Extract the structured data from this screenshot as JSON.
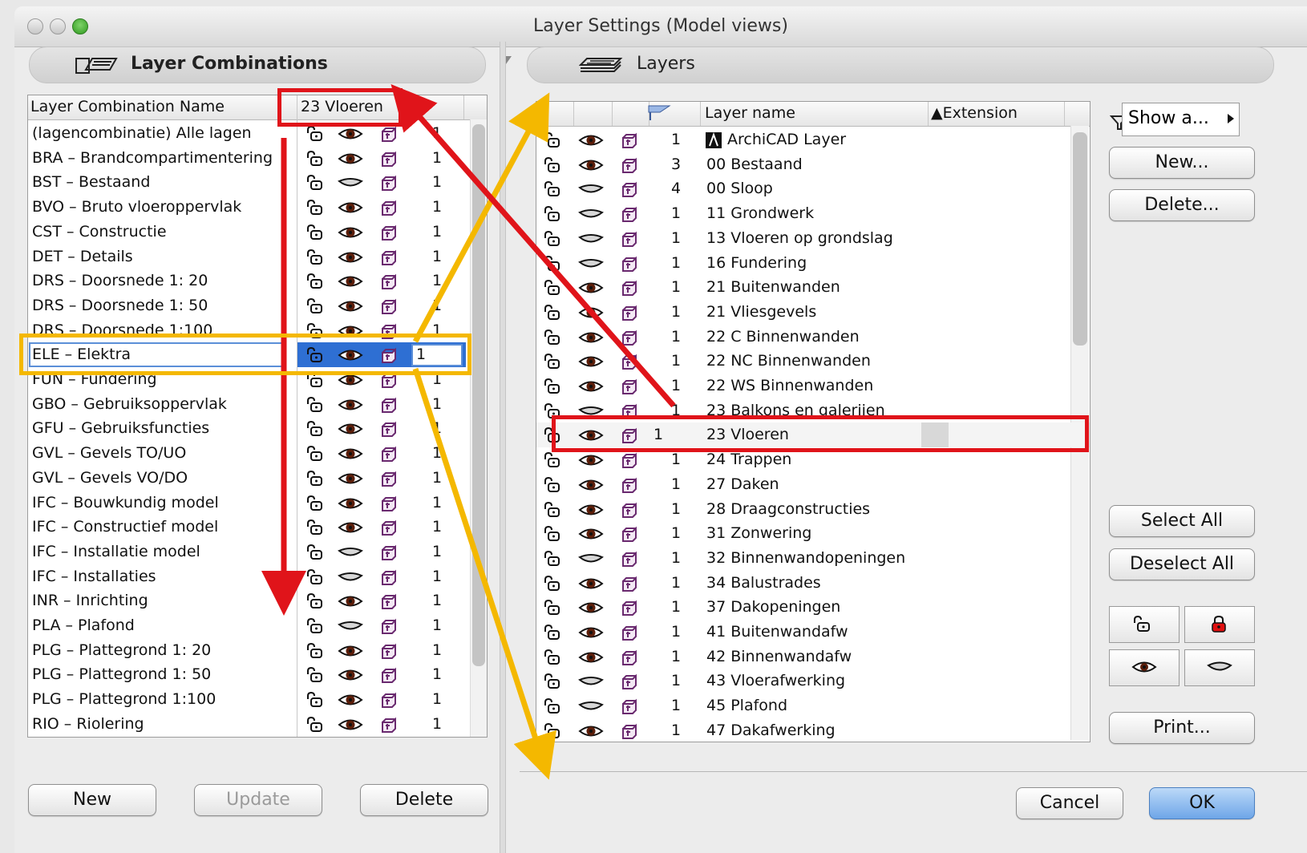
{
  "window": {
    "title": "Layer Settings (Model views)"
  },
  "left_panel": {
    "title": "Layer Combinations",
    "col_name": "Layer Combination Name",
    "col_combo": "23 Vloeren",
    "rows": [
      {
        "name": "(lagencombinatie) Alle lagen",
        "num": "1",
        "visible": true
      },
      {
        "name": "BRA – Brandcompartimentering",
        "num": "1",
        "visible": true
      },
      {
        "name": "BST – Bestaand",
        "num": "1",
        "visible": false
      },
      {
        "name": "BVO – Bruto vloeroppervlak",
        "num": "1",
        "visible": true
      },
      {
        "name": "CST – Constructie",
        "num": "1",
        "visible": true
      },
      {
        "name": "DET – Details",
        "num": "1",
        "visible": true
      },
      {
        "name": "DRS – Doorsnede 1: 20",
        "num": "1",
        "visible": true
      },
      {
        "name": "DRS – Doorsnede 1: 50",
        "num": "1",
        "visible": true
      },
      {
        "name": "DRS – Doorsnede 1:100",
        "num": "1",
        "visible": true
      },
      {
        "name": "ELE – Elektra",
        "num": "1",
        "visible": true
      },
      {
        "name": "FUN – Fundering",
        "num": "1",
        "visible": true
      },
      {
        "name": "GBO – Gebruiksoppervlak",
        "num": "1",
        "visible": true
      },
      {
        "name": "GFU – Gebruiksfuncties",
        "num": "1",
        "visible": true
      },
      {
        "name": "GVL – Gevels TO/UO",
        "num": "1",
        "visible": true
      },
      {
        "name": "GVL – Gevels VO/DO",
        "num": "1",
        "visible": true
      },
      {
        "name": "IFC – Bouwkundig model",
        "num": "1",
        "visible": true
      },
      {
        "name": "IFC – Constructief model",
        "num": "1",
        "visible": true
      },
      {
        "name": "IFC – Installatie model",
        "num": "1",
        "visible": false
      },
      {
        "name": "IFC – Installaties",
        "num": "1",
        "visible": false
      },
      {
        "name": "INR – Inrichting",
        "num": "1",
        "visible": true
      },
      {
        "name": "PLA – Plafond",
        "num": "1",
        "visible": false
      },
      {
        "name": "PLG – Plattegrond 1: 20",
        "num": "1",
        "visible": true
      },
      {
        "name": "PLG – Plattegrond 1: 50",
        "num": "1",
        "visible": true
      },
      {
        "name": "PLG – Plattegrond 1:100",
        "num": "1",
        "visible": true
      },
      {
        "name": "RIO – Riolering",
        "num": "1",
        "visible": true
      }
    ],
    "selected_row": 9,
    "buttons": {
      "new": "New",
      "update": "Update",
      "delete": "Delete"
    }
  },
  "right_panel": {
    "title": "Layers",
    "col_name": "Layer name",
    "col_ext": "▲Extension",
    "rows": [
      {
        "name": "ArchiCAD Layer",
        "num": "1",
        "visible": true,
        "special": true
      },
      {
        "name": "00 Bestaand",
        "num": "3",
        "visible": true
      },
      {
        "name": "00 Sloop",
        "num": "4",
        "visible": false
      },
      {
        "name": "11 Grondwerk",
        "num": "1",
        "visible": false
      },
      {
        "name": "13 Vloeren op grondslag",
        "num": "1",
        "visible": false
      },
      {
        "name": "16 Fundering",
        "num": "1",
        "visible": false
      },
      {
        "name": "21 Buitenwanden",
        "num": "1",
        "visible": true
      },
      {
        "name": "21 Vliesgevels",
        "num": "1",
        "visible": true
      },
      {
        "name": "22 C Binnenwanden",
        "num": "1",
        "visible": true
      },
      {
        "name": "22 NC Binnenwanden",
        "num": "1",
        "visible": true
      },
      {
        "name": "22 WS Binnenwanden",
        "num": "1",
        "visible": true
      },
      {
        "name": "23 Balkons en galerijen",
        "num": "1",
        "visible": false
      },
      {
        "name": "23 Vloeren",
        "num": "1",
        "visible": true
      },
      {
        "name": "24 Trappen",
        "num": "1",
        "visible": true
      },
      {
        "name": "27 Daken",
        "num": "1",
        "visible": true
      },
      {
        "name": "28 Draagconstructies",
        "num": "1",
        "visible": true
      },
      {
        "name": "31 Zonwering",
        "num": "1",
        "visible": true
      },
      {
        "name": "32 Binnenwandopeningen",
        "num": "1",
        "visible": false
      },
      {
        "name": "34 Balustrades",
        "num": "1",
        "visible": true
      },
      {
        "name": "37 Dakopeningen",
        "num": "1",
        "visible": true
      },
      {
        "name": "41 Buitenwandafw",
        "num": "1",
        "visible": true
      },
      {
        "name": "42 Binnenwandafw",
        "num": "1",
        "visible": true
      },
      {
        "name": "43 Vloerafwerking",
        "num": "1",
        "visible": false
      },
      {
        "name": "45 Plafond",
        "num": "1",
        "visible": false
      },
      {
        "name": "47 Dakafwerking",
        "num": "1",
        "visible": true
      }
    ],
    "selected_row": 12
  },
  "side_buttons": {
    "filter": "Show a...",
    "new": "New...",
    "delete": "Delete...",
    "select_all": "Select All",
    "deselect_all": "Deselect All",
    "print": "Print..."
  },
  "dialog_buttons": {
    "cancel": "Cancel",
    "ok": "OK"
  },
  "colors": {
    "highlight_red": "#e0141a",
    "highlight_yellow": "#f4b800",
    "selection_blue": "#2e6fd3",
    "eye_brown": "#5b1e0a",
    "lock_purple": "#6a2a6f"
  }
}
